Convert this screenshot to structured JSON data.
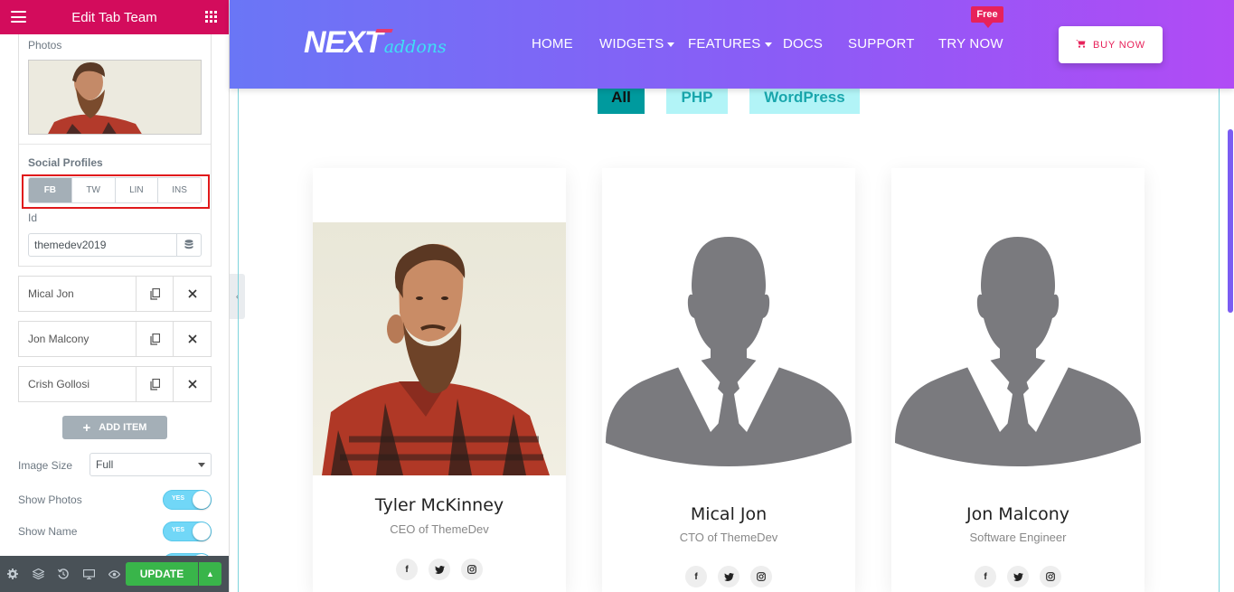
{
  "editor": {
    "title": "Edit Tab Team",
    "photos_label": "Photos",
    "social_profiles_label": "Social Profiles",
    "social_tabs": [
      "FB",
      "TW",
      "LIN",
      "INS"
    ],
    "active_social_tab": "FB",
    "id_label": "Id",
    "id_value": "themedev2019",
    "repeater_items": [
      "Mical Jon",
      "Jon Malcony",
      "Crish Gollosi"
    ],
    "add_item_label": "ADD ITEM",
    "image_size_label": "Image Size",
    "image_size_value": "Full",
    "show_photos_label": "Show Photos",
    "show_name_label": "Show Name",
    "toggle_yes": "YES",
    "update_label": "UPDATE"
  },
  "header": {
    "logo_main": "NEXT",
    "logo_sub": "addons",
    "nav": [
      "HOME",
      "WIDGETS",
      "FEATURES",
      "DOCS",
      "SUPPORT",
      "TRY NOW"
    ],
    "free_badge": "Free",
    "buy_label": "BUY NOW"
  },
  "filters": [
    "All",
    "PHP",
    "WordPress"
  ],
  "team": [
    {
      "name": "Tyler McKinney",
      "role": "CEO of ThemeDev"
    },
    {
      "name": "Mical Jon",
      "role": "CTO of ThemeDev"
    },
    {
      "name": "Jon Malcony",
      "role": "Software Engineer"
    }
  ],
  "colors": {
    "brand": "#d30c5c",
    "accent_teal": "#009a9e",
    "filter_bg": "#b2f4f7",
    "update_green": "#39b54a",
    "header_start": "#6a76f6",
    "header_end": "#b14bf5"
  },
  "icons": {
    "social": [
      "facebook-icon",
      "twitter-icon",
      "instagram-icon"
    ],
    "footer": [
      "settings-icon",
      "layers-icon",
      "history-icon",
      "responsive-icon",
      "preview-icon"
    ]
  }
}
